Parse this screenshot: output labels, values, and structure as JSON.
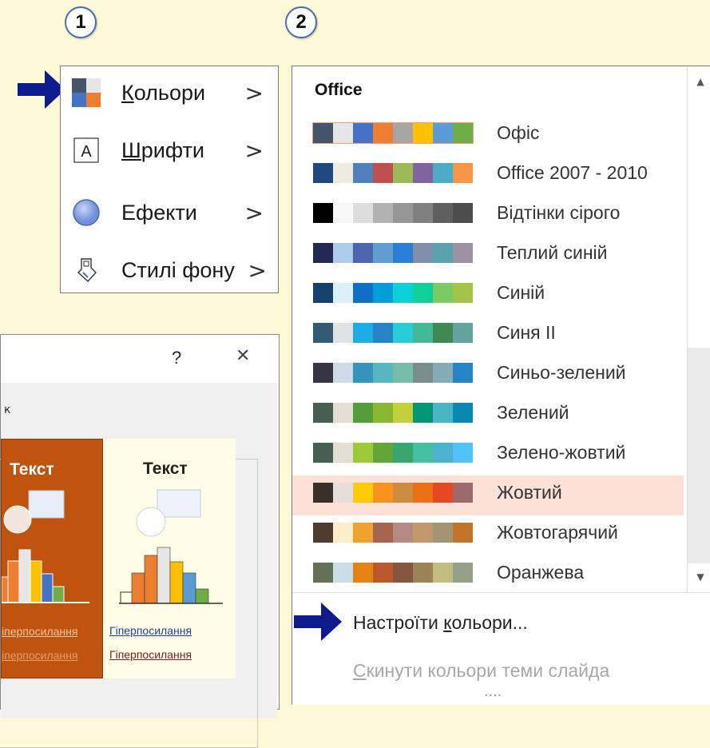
{
  "badges": {
    "step1": "1",
    "step2": "2"
  },
  "menu1": {
    "items": [
      {
        "label": "Кольори",
        "accel": "К",
        "rest": "ольори",
        "icon": "color-scheme-icon"
      },
      {
        "label": "Шрифти",
        "accel": "Ш",
        "rest": "рифти",
        "icon": "font-a-icon"
      },
      {
        "label": "Ефекти",
        "icon": "effects-circle-icon"
      },
      {
        "label": "Стилі фону",
        "icon": "background-style-icon"
      }
    ],
    "chevron": ">"
  },
  "dialog": {
    "help": "?",
    "close": "✕",
    "group_label": "к",
    "left_sample_title": "Текст",
    "right_sample_title": "Текст",
    "left_link1": "іперпосилання",
    "left_link2": "іперпосилання",
    "right_link1": "Гіперпосилання",
    "right_link2": "Гіперпосилання"
  },
  "menu2": {
    "header": "Office",
    "themes": [
      {
        "label": "Офіс",
        "colors": [
          "#44546a",
          "#e7e6e6",
          "#4472c4",
          "#ed7d31",
          "#a5a5a5",
          "#ffc000",
          "#5b9bd5",
          "#70ad47"
        ]
      },
      {
        "label": "Office 2007 - 2010",
        "colors": [
          "#1f497d",
          "#eeece1",
          "#4f81bd",
          "#c0504d",
          "#9bbb59",
          "#8064a2",
          "#4bacc6",
          "#f79646"
        ]
      },
      {
        "label": "Відтінки сірого",
        "colors": [
          "#000000",
          "#f8f8f8",
          "#dddddd",
          "#b2b2b2",
          "#969696",
          "#808080",
          "#5f5f5f",
          "#4d4d4d"
        ]
      },
      {
        "label": "Теплий синій",
        "colors": [
          "#242852",
          "#acccea",
          "#4a66ac",
          "#629dd1",
          "#297fd5",
          "#7f8fa9",
          "#5aa2ae",
          "#9d90a0"
        ]
      },
      {
        "label": "Синій",
        "colors": [
          "#17406d",
          "#dbeff9",
          "#0f6fc6",
          "#009dd9",
          "#0bd0d9",
          "#10cf9b",
          "#7cca62",
          "#a5c249"
        ]
      },
      {
        "label": "Синя II",
        "colors": [
          "#335b74",
          "#dfe3e5",
          "#1cade4",
          "#2683c6",
          "#27ced7",
          "#42ba97",
          "#3e8853",
          "#62a39f"
        ]
      },
      {
        "label": "Синьо-зелений",
        "colors": [
          "#373545",
          "#cedbe6",
          "#3494ba",
          "#58b6c0",
          "#75bda7",
          "#7a8c8e",
          "#84acb6",
          "#2683c6"
        ]
      },
      {
        "label": "Зелений",
        "colors": [
          "#455f51",
          "#e3ded1",
          "#549e39",
          "#8ab833",
          "#c0cf3a",
          "#029676",
          "#4ab5c4",
          "#0989b1"
        ]
      },
      {
        "label": "Зелено-жовтий",
        "colors": [
          "#455f51",
          "#e3ded1",
          "#99cb38",
          "#63a537",
          "#37a76f",
          "#44c1a3",
          "#4eb3cf",
          "#51c3f9"
        ]
      },
      {
        "label": "Жовтий",
        "colors": [
          "#39302a",
          "#e5dedb",
          "#ffca08",
          "#f8931d",
          "#ce8d3e",
          "#ec7016",
          "#e64823",
          "#9c6a6a"
        ]
      },
      {
        "label": "Жовтогарячий",
        "colors": [
          "#4e3b30",
          "#fbeec9",
          "#f0a22e",
          "#a5644e",
          "#b58b80",
          "#c3986d",
          "#a19574",
          "#c17529"
        ]
      },
      {
        "label": "Оранжева",
        "colors": [
          "#637052",
          "#ccddea",
          "#e48312",
          "#bd582c",
          "#865640",
          "#9b8357",
          "#c2bc80",
          "#94a088"
        ]
      }
    ],
    "scroll_up": "▲",
    "scroll_down": "▼",
    "customize_pre": "Настроїти ",
    "customize_accel": "к",
    "customize_post": "ольори...",
    "reset_accel": "С",
    "reset_rest": "кинути кольори теми слайда",
    "more": "...."
  },
  "colors": {
    "arrow": "#0d1b8c",
    "highlight": "#fbe1d8",
    "orange_sample": "#c0530e"
  }
}
